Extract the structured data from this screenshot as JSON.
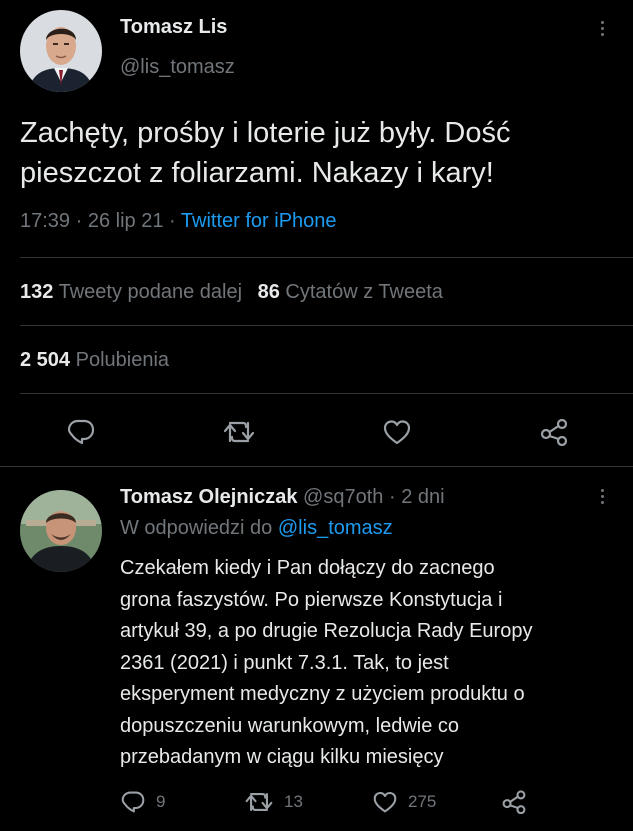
{
  "tweet": {
    "author_name": "Tomasz Lis",
    "author_handle": "@lis_tomasz",
    "text_line1": "Zachęty, prośby i loterie już były. Dość",
    "text_line2": "pieszczot z foliarzami. Nakazy i kary!",
    "time": "17:39",
    "date": "26 lip 21",
    "sep": "·",
    "source": "Twitter for iPhone",
    "retweets_count": "132",
    "retweets_label": "Tweety podane dalej",
    "quotes_count": "86",
    "quotes_label": "Cytatów z Tweeta",
    "likes_count": "2 504",
    "likes_label": "Polubienia"
  },
  "reply": {
    "author_name": "Tomasz Olejniczak",
    "author_handle": "@sq7oth",
    "sep": "·",
    "age": "2 dni",
    "reply_prefix": "W odpowiedzi do",
    "reply_to": "@lis_tomasz",
    "lines": [
      "Czekałem kiedy i Pan dołączy do zacnego",
      "grona faszystów. Po pierwsze Konstytucja i",
      "artykuł 39, a po drugie Rezolucja Rady Europy",
      "2361 (2021) i punkt 7.3.1. Tak, to jest",
      "eksperyment medyczny z użyciem produktu o",
      "dopuszczeniu warunkowym, ledwie co",
      "przebadanym w ciągu kilku miesięcy"
    ],
    "replies_count": "9",
    "retweets_count": "13",
    "likes_count": "275"
  },
  "icons": {
    "more": "more-vertical-icon",
    "reply": "speech-bubble-icon",
    "retweet": "retweet-icon",
    "like": "heart-icon",
    "share": "share-icon"
  },
  "colors": {
    "background": "#000000",
    "text": "#e7e9ea",
    "muted": "#71767b",
    "link": "#1d9bf0",
    "divider": "#2f3336"
  }
}
